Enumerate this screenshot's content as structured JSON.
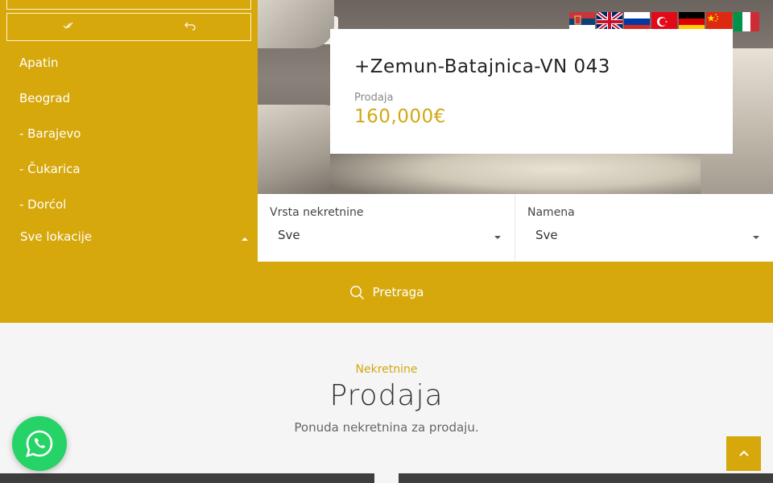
{
  "hero": {
    "title": "+Zemun-Batajnica-VN 043",
    "type_label": "Prodaja",
    "price": "160,000€"
  },
  "languages": [
    {
      "icon": "serbia-flag-icon"
    },
    {
      "icon": "uk-flag-icon"
    },
    {
      "icon": "russia-flag-icon"
    },
    {
      "icon": "turkey-flag-icon"
    },
    {
      "icon": "germany-flag-icon"
    },
    {
      "icon": "china-flag-icon"
    },
    {
      "icon": "italy-flag-icon"
    }
  ],
  "location_dropdown": {
    "select_all_icon": "double-check-icon",
    "reset_icon": "undo-icon",
    "items": [
      "Apatin",
      "Beograd",
      "- Barajevo",
      "- Čukarica",
      "- Dorćol"
    ],
    "selected": "Sve lokacije"
  },
  "filters": {
    "type": {
      "label": "Vrsta nekretnine",
      "value": "Sve"
    },
    "purpose": {
      "label": "Namena",
      "value": "Sve"
    }
  },
  "search": {
    "label": "Pretraga",
    "icon": "search-icon"
  },
  "section": {
    "eyebrow": "Nekretnine",
    "heading": "Prodaja",
    "description": "Ponuda nekretnina za prodaju."
  },
  "colors": {
    "accent": "#d6a80c",
    "whatsapp": "#25d366"
  }
}
